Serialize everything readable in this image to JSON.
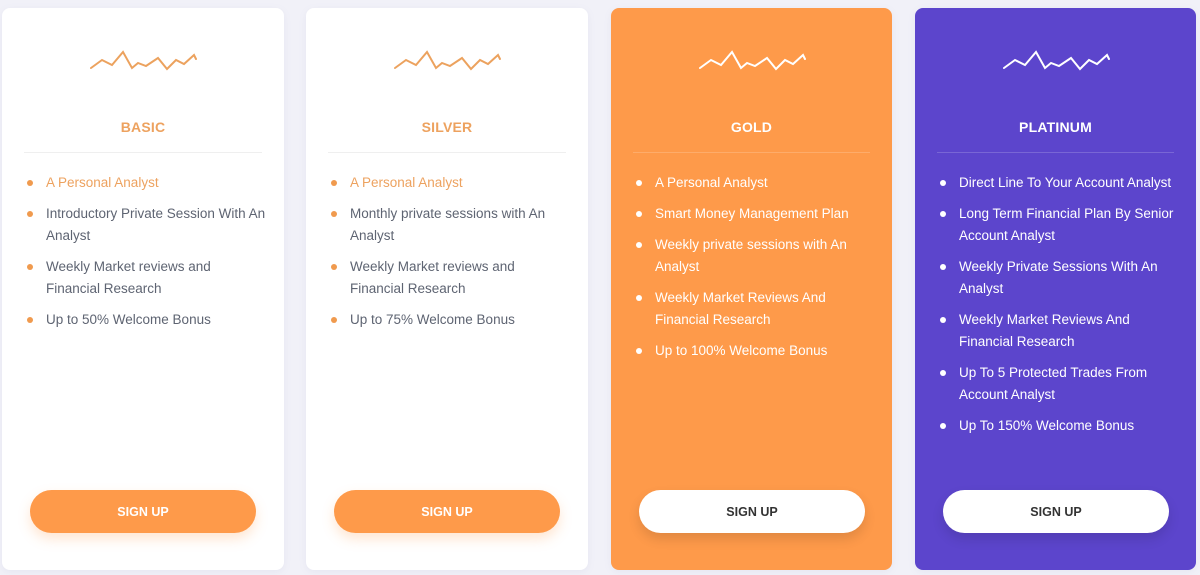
{
  "plans": [
    {
      "name": "BASIC",
      "icon": "sparkline-icon",
      "features": [
        {
          "text": "A Personal Analyst",
          "highlighted": true
        },
        {
          "text": "Introductory Private Session With An Analyst",
          "highlighted": false
        },
        {
          "text": "Weekly Market reviews and Financial Research",
          "highlighted": false
        },
        {
          "text": "Up to 50% Welcome Bonus",
          "highlighted": false
        }
      ],
      "cta": "SIGN UP"
    },
    {
      "name": "SILVER",
      "icon": "sparkline-icon",
      "features": [
        {
          "text": "A Personal Analyst",
          "highlighted": true
        },
        {
          "text": "Monthly private sessions with An Analyst",
          "highlighted": false
        },
        {
          "text": "Weekly Market reviews and Financial Research",
          "highlighted": false
        },
        {
          "text": "Up to 75% Welcome Bonus",
          "highlighted": false
        }
      ],
      "cta": "SIGN UP"
    },
    {
      "name": "GOLD",
      "icon": "sparkline-icon",
      "features": [
        {
          "text": "A Personal Analyst",
          "highlighted": false
        },
        {
          "text": "Smart Money Management Plan",
          "highlighted": false
        },
        {
          "text": "Weekly private sessions with An Analyst",
          "highlighted": false
        },
        {
          "text": "Weekly Market Reviews And Financial Research",
          "highlighted": false
        },
        {
          "text": "Up to 100% Welcome Bonus",
          "highlighted": false
        }
      ],
      "cta": "SIGN UP"
    },
    {
      "name": "PLATINUM",
      "icon": "sparkline-icon",
      "features": [
        {
          "text": "Direct Line To Your Account Analyst",
          "highlighted": false
        },
        {
          "text": "Long Term Financial Plan By Senior Account Analyst",
          "highlighted": false
        },
        {
          "text": "Weekly Private Sessions With An Analyst",
          "highlighted": false
        },
        {
          "text": "Weekly Market Reviews And Financial Research",
          "highlighted": false
        },
        {
          "text": "Up To 5 Protected Trades From Account Analyst",
          "highlighted": false
        },
        {
          "text": "Up To 150% Welcome Bonus",
          "highlighted": false
        }
      ],
      "cta": "SIGN UP"
    }
  ],
  "colors": {
    "accent_orange": "#fe9a4a",
    "accent_purple": "#5c45cc",
    "title_orange": "#eda25f",
    "body_text": "#5e6472",
    "background": "#f1f1f8"
  }
}
